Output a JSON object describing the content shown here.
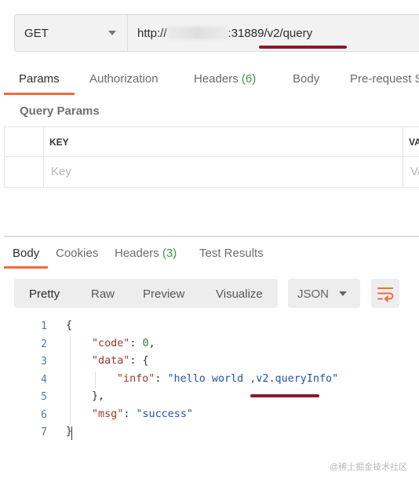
{
  "request": {
    "method": "GET",
    "url_prefix": "http://",
    "url_suffix": ":31889/v2/query"
  },
  "request_tabs": [
    {
      "label": "Params"
    },
    {
      "label": "Authorization"
    },
    {
      "label": "Headers",
      "count": "(6)"
    },
    {
      "label": "Body"
    },
    {
      "label": "Pre-request S"
    }
  ],
  "params": {
    "title": "Query Params",
    "columns": [
      "KEY",
      "VA"
    ],
    "placeholders": [
      "Key",
      "Va"
    ]
  },
  "response_tabs": [
    {
      "label": "Body"
    },
    {
      "label": "Cookies"
    },
    {
      "label": "Headers",
      "count": "(3)"
    },
    {
      "label": "Test Results"
    }
  ],
  "view_modes": [
    "Pretty",
    "Raw",
    "Preview",
    "Visualize"
  ],
  "format": "JSON",
  "code": {
    "line_numbers": [
      "1",
      "2",
      "3",
      "4",
      "5",
      "6",
      "7"
    ],
    "open_brace": "{",
    "code_key": "\"code\"",
    "code_value": "0",
    "data_key": "\"data\"",
    "info_key": "\"info\"",
    "info_value": "\"hello world ,v2.queryInfo\"",
    "msg_key": "\"msg\"",
    "msg_value": "\"success\"",
    "close_inner": "},",
    "close_brace": "}"
  },
  "watermark": "@稀土掘金技术社区",
  "colors": {
    "active_tab_underline": "#f26b3a",
    "annotation_underline": "#8b1a2b",
    "count_green": "#3a9a4a",
    "json_key": "#a1352b",
    "json_string": "#2452a8",
    "json_number": "#2f7f34"
  }
}
